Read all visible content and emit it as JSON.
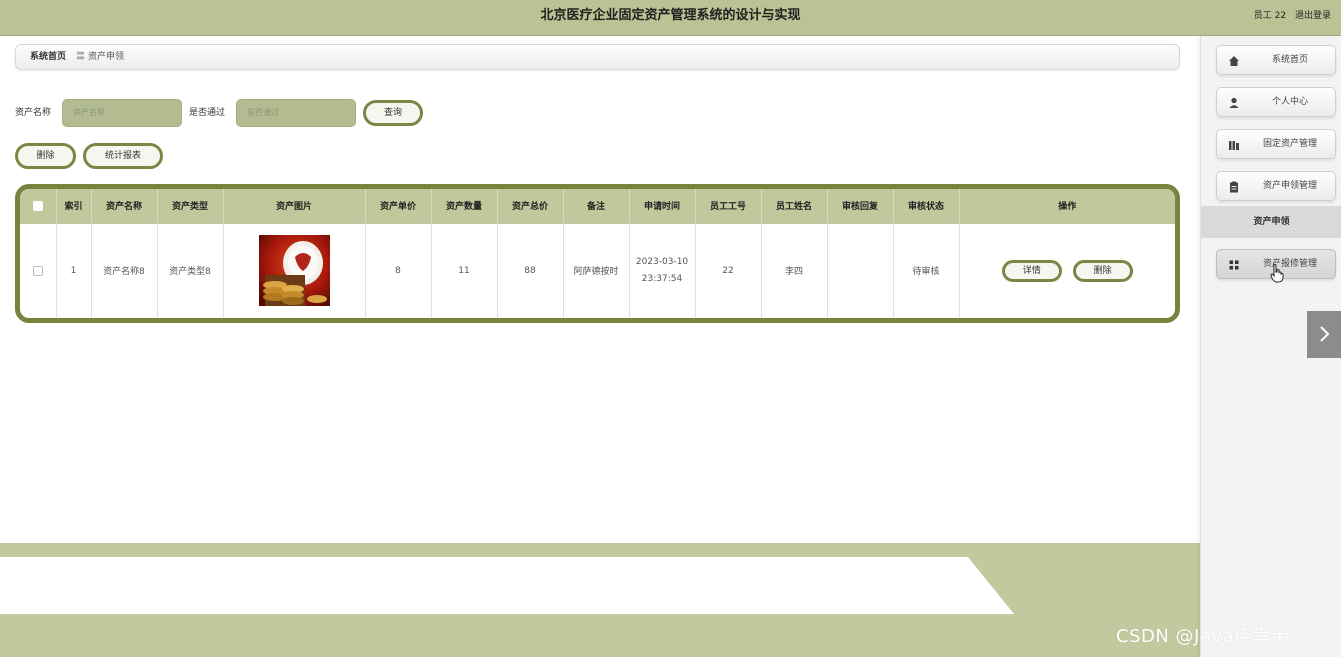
{
  "header": {
    "title": "北京医疗企业固定资产管理系统的设计与实现",
    "user": "员工 22",
    "logout": "退出登录"
  },
  "breadcrumb": {
    "home": "系统首页",
    "separator": "〓",
    "current": "资产申领"
  },
  "search": {
    "name_label": "资产名称",
    "name_placeholder": "资产名称",
    "pass_label": "是否通过",
    "pass_placeholder": "是否通过",
    "query_label": "查询"
  },
  "toolbar": {
    "delete_label": "删除",
    "report_label": "统计报表"
  },
  "table": {
    "headers": [
      "",
      "索引",
      "资产名称",
      "资产类型",
      "资产图片",
      "资产单价",
      "资产数量",
      "资产总价",
      "备注",
      "申请时间",
      "员工工号",
      "员工姓名",
      "审核回复",
      "审核状态",
      "操作"
    ],
    "rows": [
      {
        "index": "1",
        "name": "资产名称8",
        "type": "资产类型8",
        "price": "8",
        "quantity": "11",
        "total": "88",
        "remark": "阿萨德按时",
        "time": "2023-03-10 23:37:54",
        "emp_no": "22",
        "emp_name": "李四",
        "reply": "",
        "status": "待审核",
        "detail_label": "详情",
        "delete_label": "删除"
      }
    ]
  },
  "sidebar": {
    "items": [
      {
        "label": "系统首页",
        "icon": "home-icon"
      },
      {
        "label": "个人中心",
        "icon": "user-icon"
      },
      {
        "label": "固定资产管理",
        "icon": "bar-icon"
      },
      {
        "label": "资产申领管理",
        "icon": "clipboard-icon"
      },
      {
        "label": "资产申领",
        "icon": ""
      },
      {
        "label": "资产报修管理",
        "icon": "grid-icon"
      }
    ]
  },
  "watermark": "CSDN @Java侥幸弟",
  "colors": {
    "accent": "#77833f",
    "header": "#b9c394",
    "table_header": "#c1c99c"
  }
}
